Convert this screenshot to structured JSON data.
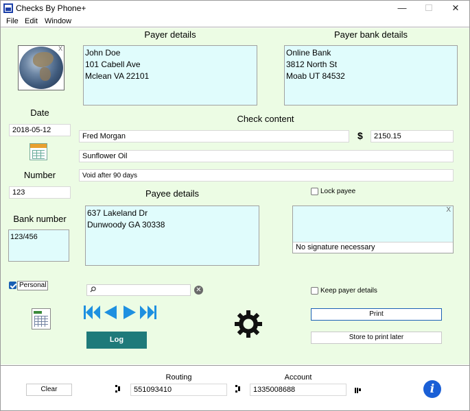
{
  "window": {
    "title": "Checks By Phone+",
    "minimize": "—",
    "maximize": "☐",
    "close": "✕"
  },
  "menu": [
    "File",
    "Edit",
    "Window"
  ],
  "payer": {
    "heading": "Payer details",
    "lines": [
      "John Doe",
      "101 Cabell Ave",
      "Mclean VA 22101"
    ],
    "image_close": "X"
  },
  "payer_bank": {
    "heading": "Payer bank details",
    "lines": [
      "Online Bank",
      "3812 North St",
      "Moab UT 84532"
    ]
  },
  "date": {
    "label": "Date",
    "value": "2018-05-12"
  },
  "number": {
    "label": "Number",
    "value": "123"
  },
  "bank_number": {
    "label": "Bank number",
    "value": "123/456"
  },
  "personal": {
    "label": "Personal",
    "checked": true
  },
  "check": {
    "heading": "Check content",
    "payee_name": "Fred Morgan",
    "currency_symbol": "$",
    "amount": "2150.15",
    "memo": "Sunflower Oil",
    "note": "Void after 90 days"
  },
  "payee": {
    "heading": "Payee details",
    "lines": [
      "637 Lakeland Dr",
      "Dunwoody GA 30338"
    ]
  },
  "lock_payee": {
    "label": "Lock payee",
    "checked": false
  },
  "signature": {
    "close": "X",
    "text": "No signature necessary"
  },
  "keep_payer": {
    "label": "Keep payer details",
    "checked": false
  },
  "search": {
    "value": "",
    "clear": "✕"
  },
  "buttons": {
    "print": "Print",
    "store": "Store to print later",
    "log": "Log",
    "clear": "Clear"
  },
  "routing": {
    "label": "Routing",
    "value": "551093410"
  },
  "account": {
    "label": "Account",
    "value": "1335008688"
  },
  "info": "i",
  "colors": {
    "panel_bg": "#ecfce4",
    "field_bg": "#e0fcfc",
    "log_button": "#1f7a7a",
    "nav_arrows": "#1e90e0",
    "info_icon": "#1a5fd6"
  },
  "icons": [
    "app-icon",
    "earth-image",
    "calendar-icon",
    "search-icon",
    "first-icon",
    "previous-icon",
    "next-icon",
    "last-icon",
    "gear-icon",
    "spreadsheet-icon",
    "micr-transit-icon",
    "micr-on-us-icon",
    "info-icon"
  ]
}
